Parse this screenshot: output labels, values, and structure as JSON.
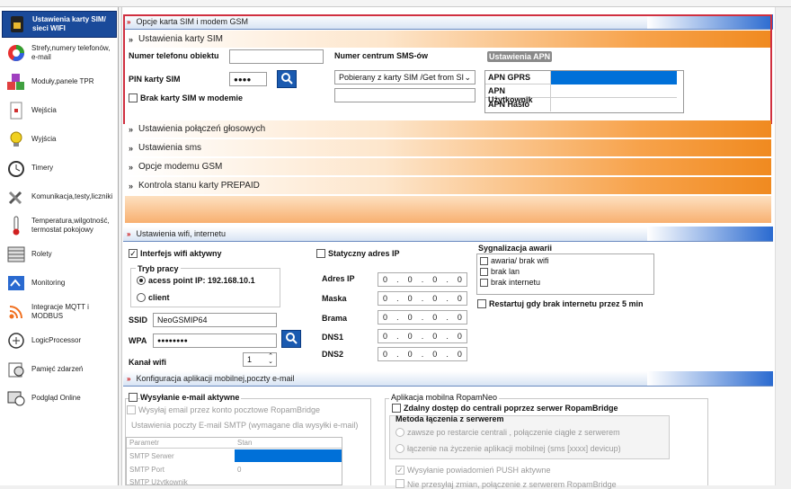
{
  "sidebar": {
    "items": [
      {
        "label": "Ustawienia karty SIM/ sieci WIFI",
        "icon": "sim-card-icon"
      },
      {
        "label": "Strefy,numery telefonów, e-mail",
        "icon": "pie-chart-icon"
      },
      {
        "label": "Moduły,panele TPR",
        "icon": "cubes-icon"
      },
      {
        "label": "Wejścia",
        "icon": "door-sensor-icon"
      },
      {
        "label": "Wyjścia",
        "icon": "lightbulb-icon"
      },
      {
        "label": "Timery",
        "icon": "clock-icon"
      },
      {
        "label": "Komunikacja,testy,liczniki",
        "icon": "tools-icon"
      },
      {
        "label": "Temperatura,wilgotność, termostat pokojowy",
        "icon": "thermometer-icon"
      },
      {
        "label": "Rolety",
        "icon": "blinds-icon"
      },
      {
        "label": "Monitoring",
        "icon": "monitoring-icon"
      },
      {
        "label": "Integracje MQTT i MODBUS",
        "icon": "rss-icon"
      },
      {
        "label": "LogicProcessor",
        "icon": "logic-icon"
      },
      {
        "label": "Pamięć zdarzeń",
        "icon": "event-memory-icon"
      },
      {
        "label": "Podgląd Online",
        "icon": "online-view-icon"
      }
    ]
  },
  "sim_section": {
    "header": "Opcje karta SIM i modem GSM",
    "subheader": "Ustawienia karty SIM",
    "phone_label": "Numer telefonu obiektu",
    "phone_value": "",
    "pin_label": "PIN karty SIM",
    "pin_value": "●●●●",
    "no_sim_label": "Brak karty SIM w modemie",
    "sms_center_label": "Numer centrum SMS-ów",
    "sms_center_select": "Pobierany z karty SIM /Get from SI",
    "sms_center_value": "",
    "apn_title": "Ustawienia APN",
    "apn_rows": [
      {
        "label": "APN GPRS",
        "value": ""
      },
      {
        "label": "APN Użytkownik",
        "value": ""
      },
      {
        "label": "APN Hasło",
        "value": ""
      }
    ]
  },
  "collapsed": [
    "Ustawienia połączeń głosowych",
    "Ustawienia sms",
    "Opcje modemu GSM",
    "Kontrola stanu karty PREPAID"
  ],
  "wifi_section": {
    "header": "Ustawienia wifi, internetu",
    "wifi_active_label": "Interfejs wifi aktywny",
    "mode_title": "Tryb pracy",
    "mode_ap": "acess point IP: 192.168.10.1",
    "mode_client": "client",
    "ssid_label": "SSID",
    "ssid_value": "NeoGSMIP64",
    "wpa_label": "WPA",
    "wpa_value": "●●●●●●●●",
    "channel_label": "Kanał wifi",
    "channel_value": "1",
    "static_ip_label": "Statyczny adres IP",
    "ip_rows": [
      {
        "label": "Adres IP",
        "octets": [
          "0",
          "0",
          "0",
          "0"
        ]
      },
      {
        "label": "Maska",
        "octets": [
          "0",
          "0",
          "0",
          "0"
        ]
      },
      {
        "label": "Brama",
        "octets": [
          "0",
          "0",
          "0",
          "0"
        ]
      },
      {
        "label": "DNS1",
        "octets": [
          "0",
          "0",
          "0",
          "0"
        ]
      },
      {
        "label": "DNS2",
        "octets": [
          "0",
          "0",
          "0",
          "0"
        ]
      }
    ],
    "alarm_title": "Sygnalizacja awarii",
    "alarm_items": [
      "awaria/ brak wifi",
      "brak lan",
      "brak internetu"
    ],
    "restart_label": "Restartuj gdy brak internetu przez 5 min"
  },
  "mobile_section": {
    "header": "Konfiguracja aplikacji mobilnej,poczty e-mail",
    "email_active_label": "Wysyłanie e-mail aktywne",
    "email_bridge_label": "Wysyłaj email przez konto pocztowe RopamBridge",
    "smtp_title": "Ustawienia poczty E-mail SMTP (wymagane dla wysyłki e-mail)",
    "table_headers": [
      "Parametr",
      "Stan"
    ],
    "table_rows": [
      {
        "param": "SMTP Serwer",
        "value": ""
      },
      {
        "param": "SMTP Port",
        "value": "0"
      },
      {
        "param": "SMTP Użytkownik",
        "value": ""
      }
    ],
    "app_title": "Aplikacja mobilna RopamNeo",
    "remote_label": "Zdalny dostęp do centrali poprzez serwer RopamBridge",
    "method_title": "Metoda łączenia z serwerem",
    "method_always": "zawsze po restarcie centrali , połączenie ciągłe z serwerem",
    "method_on_request": "łączenie na życzenie aplikacji mobilnej  (sms [xxxx] devicup)",
    "push_label": "Wysyłanie powiadomień PUSH aktywne",
    "cut_label": "Nie przesyłaj zmian, połączenie z serwerem RopamBridge"
  },
  "colors": {
    "accent_blue": "#1a4a9a",
    "orange": "#f08a20",
    "red_frame": "#d03040"
  }
}
